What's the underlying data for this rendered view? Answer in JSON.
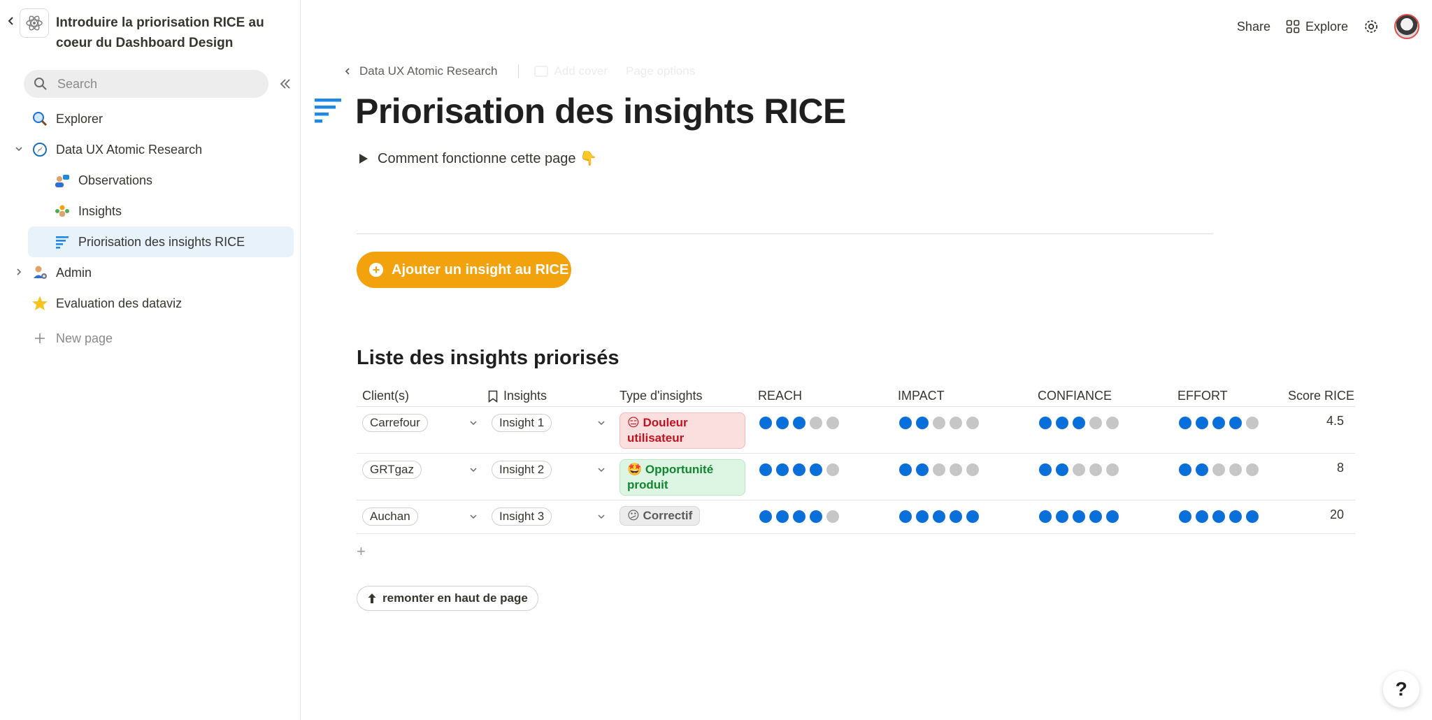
{
  "workspace": {
    "title": "Introduire la priorisation RICE au coeur du Dashboard Design"
  },
  "sidebar": {
    "search_placeholder": "Search",
    "items": [
      {
        "label": "Explorer",
        "icon": "magnifier-icon"
      },
      {
        "label": "Data UX Atomic Research",
        "icon": "compass-icon",
        "expanded": true
      },
      {
        "label": "Observations",
        "icon": "people-chat-icon"
      },
      {
        "label": "Insights",
        "icon": "team-icon"
      },
      {
        "label": "Priorisation des insights RICE",
        "icon": "sort-lines-icon",
        "active": true
      },
      {
        "label": "Admin",
        "icon": "admin-person-icon"
      },
      {
        "label": "Evaluation des dataviz",
        "icon": "star-icon"
      }
    ],
    "new_page": "New page"
  },
  "topbar": {
    "share": "Share",
    "explore": "Explore"
  },
  "breadcrumb": {
    "parent": "Data UX Atomic Research",
    "add_cover": "Add cover",
    "page_options": "Page options"
  },
  "page": {
    "title": "Priorisation des insights RICE",
    "toggle_text": "Comment fonctionne cette page 👇",
    "cta_label": "Ajouter un insight au RICE",
    "section_title": "Liste des insights priorisés",
    "back_to_top": "remonter en haut de page"
  },
  "table": {
    "columns": [
      "Client(s)",
      "Insights",
      "Type d'insights",
      "REACH",
      "IMPACT",
      "CONFIANCE",
      "EFFORT",
      "Score RICE"
    ],
    "rows": [
      {
        "client": "Carrefour",
        "insight": "Insight 1",
        "type": "😑 Douleur utilisateur",
        "type_color": "red",
        "reach": 3,
        "impact": 2,
        "confiance": 3,
        "effort": 4,
        "score": "4.5"
      },
      {
        "client": "GRTgaz",
        "insight": "Insight 2",
        "type": "🤩 Opportunité produit",
        "type_color": "green",
        "reach": 4,
        "impact": 2,
        "confiance": 2,
        "effort": 2,
        "score": "8"
      },
      {
        "client": "Auchan",
        "insight": "Insight 3",
        "type": "😕 Correctif",
        "type_color": "grey",
        "reach": 4,
        "impact": 5,
        "confiance": 5,
        "effort": 5,
        "score": "20"
      }
    ],
    "dot_total": 5
  },
  "help_label": "?",
  "colors": {
    "accent_orange": "#f2a20c",
    "dot_on": "#0a6fd8",
    "dot_off": "#c6c6c6",
    "active_bg": "#e8f2fb"
  }
}
